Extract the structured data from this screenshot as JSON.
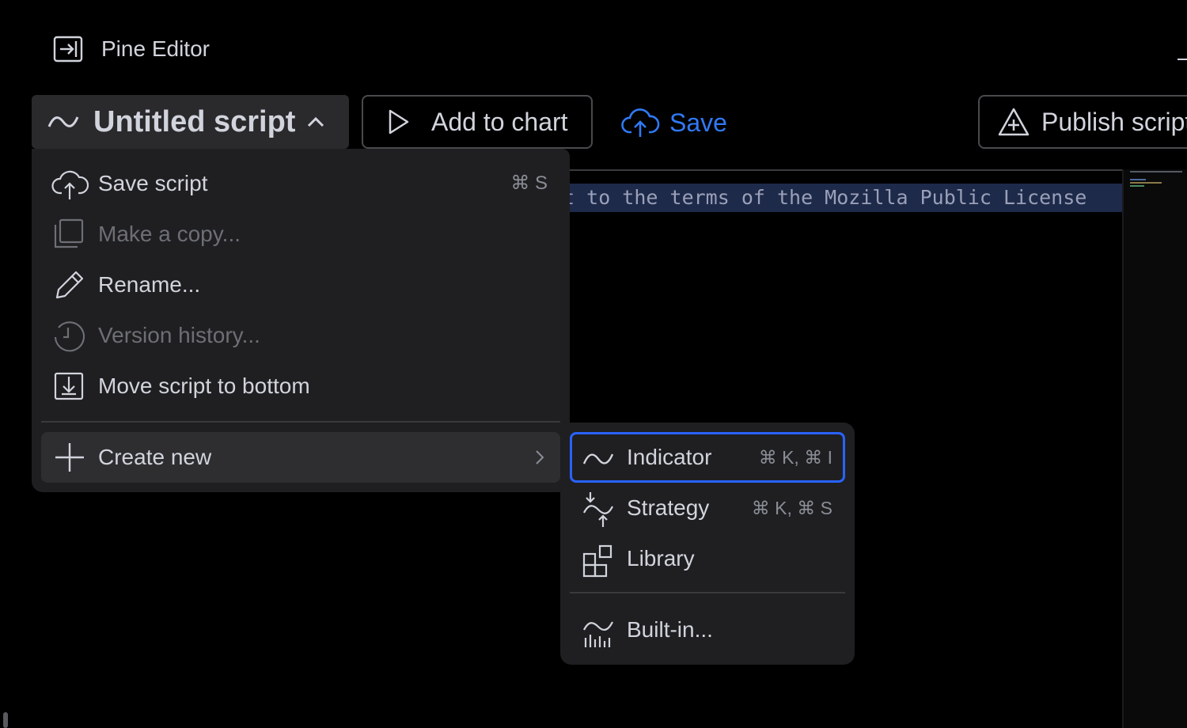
{
  "header": {
    "title": "Pine Editor",
    "panel_icon": "panel-enter-icon"
  },
  "toolbar": {
    "script_name": "Untitled script",
    "script_icon": "indicator-wave-icon",
    "add_to_chart": "Add to chart",
    "save": "Save",
    "publish": "Publish script",
    "accent_color": "#3179f5"
  },
  "editor": {
    "visible_line": "ct to the terms of the Mozilla Public License"
  },
  "menu": {
    "items": [
      {
        "label": "Save script",
        "shortcut": "⌘ S",
        "icon": "cloud-upload-icon",
        "disabled": false
      },
      {
        "label": "Make a copy...",
        "icon": "copy-icon",
        "disabled": true
      },
      {
        "label": "Rename...",
        "icon": "pencil-icon",
        "disabled": false
      },
      {
        "label": "Version history...",
        "icon": "history-icon",
        "disabled": true
      },
      {
        "label": "Move script to bottom",
        "icon": "move-bottom-icon",
        "disabled": false
      }
    ],
    "create_new": {
      "label": "Create new",
      "icon": "plus-icon"
    }
  },
  "submenu": {
    "items": [
      {
        "label": "Indicator",
        "shortcut": "⌘ K, ⌘ I",
        "icon": "indicator-wave-icon",
        "focused": true
      },
      {
        "label": "Strategy",
        "shortcut": "⌘ K, ⌘ S",
        "icon": "strategy-icon"
      },
      {
        "label": "Library",
        "icon": "library-icon"
      },
      {
        "label": "Built-in...",
        "icon": "built-in-chart-icon"
      }
    ],
    "focus_color": "#2962ff"
  }
}
